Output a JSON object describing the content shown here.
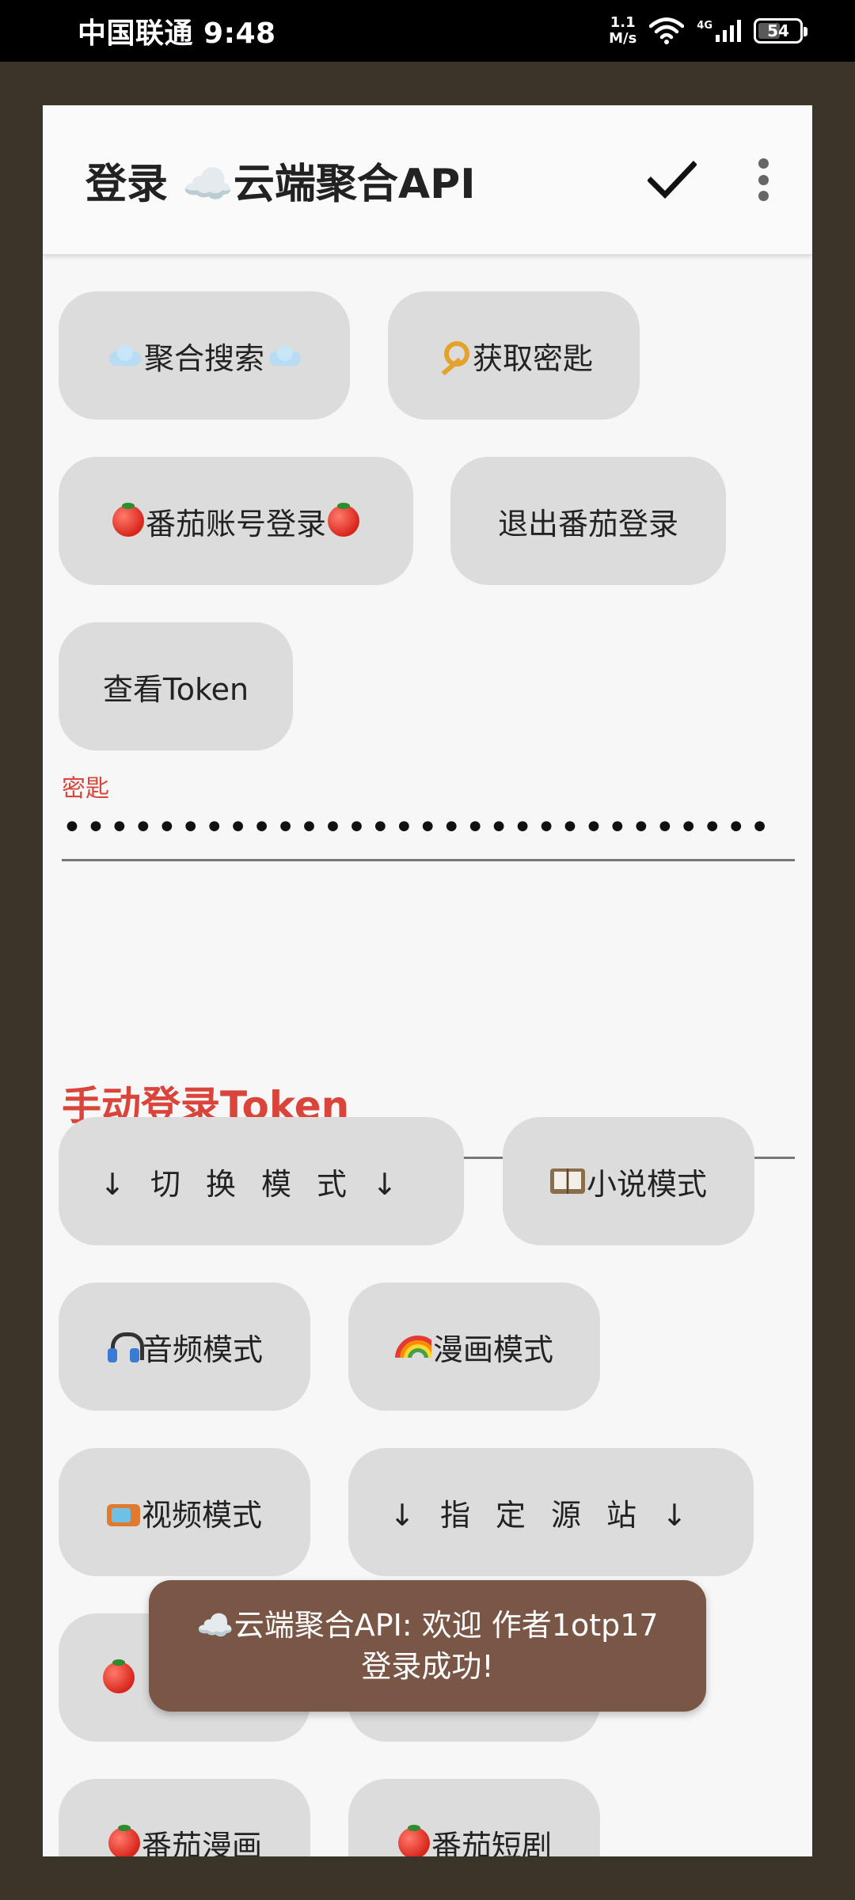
{
  "status_bar": {
    "carrier_time": "中国联通 9:48",
    "speed_value": "1.1",
    "speed_unit": "M/s",
    "network": "4G",
    "battery": "54",
    "battery_level": 0.54
  },
  "dialog": {
    "title": "登录 ☁️云端聚合API",
    "confirm_icon": "check-icon",
    "more_icon": "more-vert-icon"
  },
  "buttons": {
    "aggregate_search": "聚合搜索",
    "get_key": "获取密匙",
    "tomato_login": "番茄账号登录",
    "tomato_logout": "退出番茄登录",
    "view_token": "查看Token",
    "switch_mode": "↓切换模式↓",
    "novel_mode": "小说模式",
    "audio_mode": "音频模式",
    "comic_mode": "漫画模式",
    "video_mode": "视频模式",
    "specify_source": "↓指定源站↓",
    "tomato_comic": "番茄漫画",
    "tomato_drama": "番茄短剧"
  },
  "key_field": {
    "label": "密匙",
    "value": "••••••••••••••••••••••••••••••"
  },
  "manual_token": {
    "title": "手动登录Token"
  },
  "toast": {
    "line1": "☁️云端聚合API: 欢迎 作者1otp17",
    "line2": "登录成功!"
  },
  "colors": {
    "accent": "#d9453a",
    "button_bg": "#dcdcdc",
    "toast_bg": "#7a5646",
    "backdrop": "#3b3428"
  }
}
